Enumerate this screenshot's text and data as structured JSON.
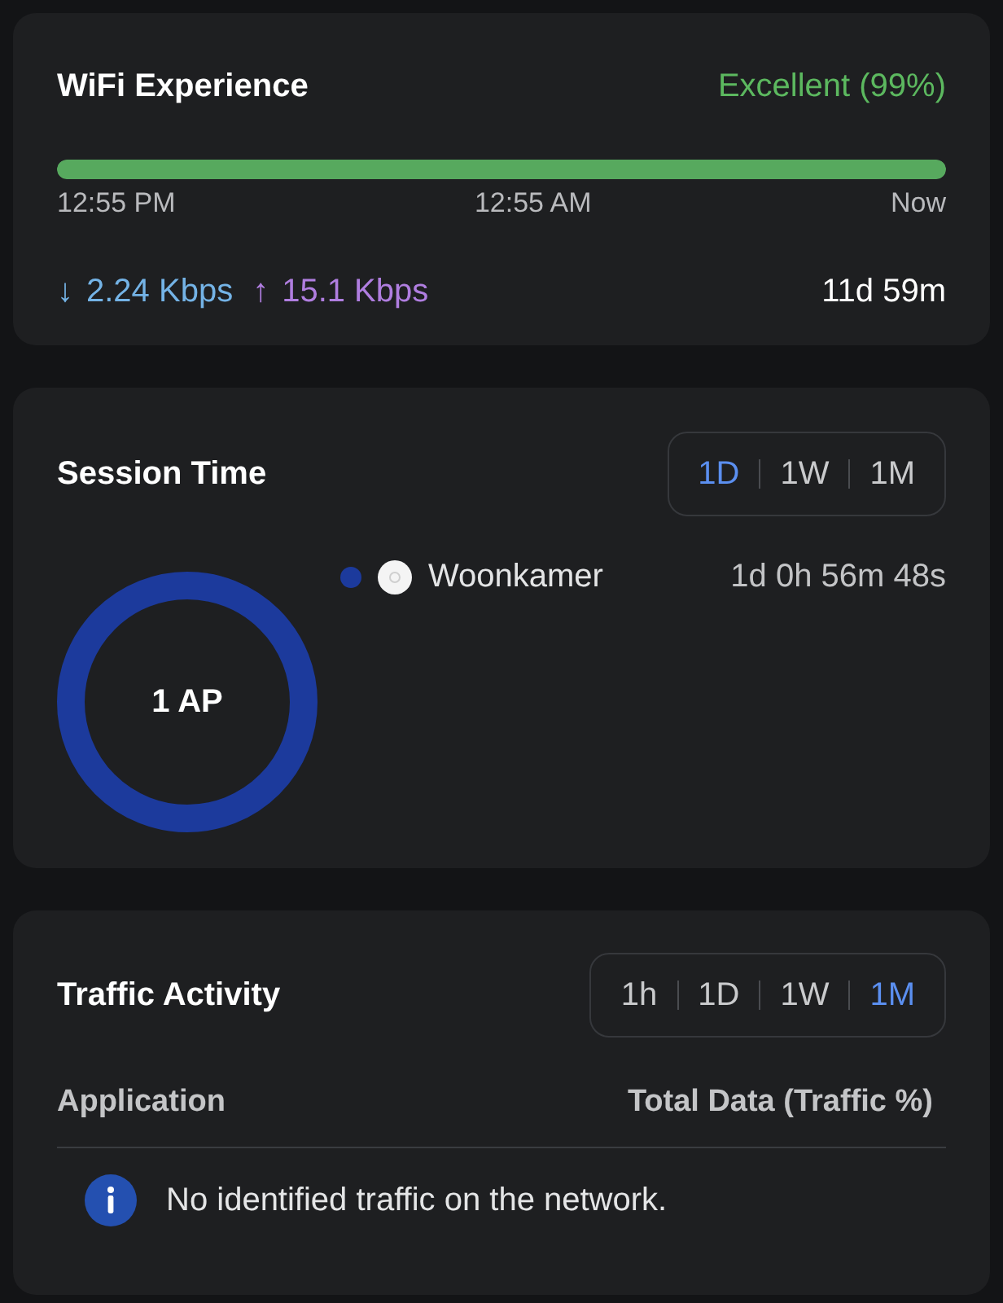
{
  "wifi_experience": {
    "title": "WiFi Experience",
    "rating": "Excellent (99%)",
    "level": 1,
    "timeline_labels": [
      "12:55 PM",
      "12:55 AM",
      "Now"
    ],
    "download": {
      "arrow": "↓",
      "rate": "2.24 Kbps"
    },
    "upload": {
      "arrow": "↑",
      "rate": "15.1 Kbps"
    },
    "uptime": "11d 59m"
  },
  "session_time": {
    "title": "Session Time",
    "ranges": [
      {
        "label": "1D",
        "selected": true
      },
      {
        "label": "1W",
        "selected": false
      },
      {
        "label": "1M",
        "selected": false
      }
    ],
    "donut_label": "1 AP",
    "legend": [
      {
        "name": "Woonkamer",
        "duration": "1d 0h 56m 48s",
        "color": "#1c3a9c"
      }
    ]
  },
  "traffic_activity": {
    "title": "Traffic Activity",
    "ranges": [
      {
        "label": "1h",
        "selected": false
      },
      {
        "label": "1D",
        "selected": false
      },
      {
        "label": "1W",
        "selected": false
      },
      {
        "label": "1M",
        "selected": true
      }
    ],
    "columns": [
      "Application",
      "Total Data (Traffic %)"
    ],
    "empty_message": "No identified traffic on the network."
  }
}
